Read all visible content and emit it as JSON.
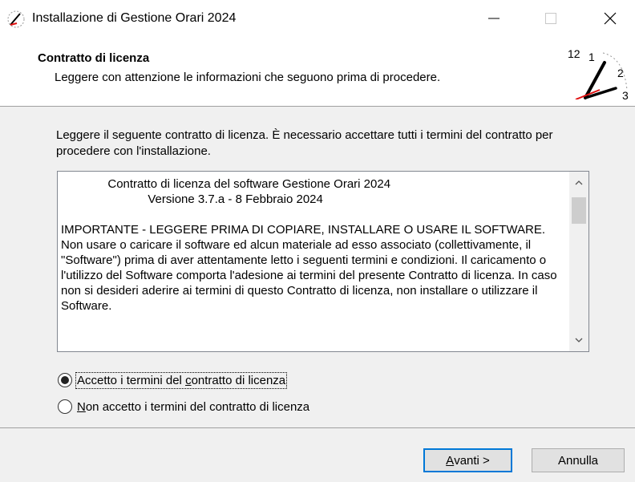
{
  "window": {
    "title": "Installazione di Gestione Orari 2024",
    "minimize_label": "—",
    "close_label": "✕"
  },
  "header": {
    "title": "Contratto di licenza",
    "subtitle": "Leggere con attenzione le informazioni che seguono prima di procedere.",
    "clock_numbers": [
      "12",
      "1",
      "2",
      "3"
    ]
  },
  "intro": "Leggere il seguente contratto di licenza. È necessario accettare tutti i termini del contratto per procedere con l'installazione.",
  "license": {
    "text": "              Contratto di licenza del software Gestione Orari 2024\n                          Versione 3.7.a - 8 Febbraio 2024\n\nIMPORTANTE - LEGGERE PRIMA DI COPIARE, INSTALLARE O USARE IL SOFTWARE.\nNon usare o caricare il software ed alcun materiale ad esso associato (collettivamente, il \"Software\") prima di aver attentamente letto i seguenti termini e condizioni. Il caricamento o l'utilizzo del Software comporta l'adesione ai termini del presente Contratto di licenza. In caso non si desideri aderire ai termini di questo Contratto di licenza, non installare o utilizzare il Software."
  },
  "options": {
    "accept": {
      "before": "Accetto i termini del ",
      "accel": "c",
      "after": "ontratto di licenza",
      "checked": true
    },
    "decline": {
      "before": "",
      "accel": "N",
      "after": "on accetto i termini del contratto di licenza",
      "checked": false
    }
  },
  "buttons": {
    "next": {
      "accel": "A",
      "rest": "vanti >"
    },
    "cancel": "Annulla"
  },
  "colors": {
    "accent": "#0078d7",
    "clock_hand_red": "#e01010"
  }
}
